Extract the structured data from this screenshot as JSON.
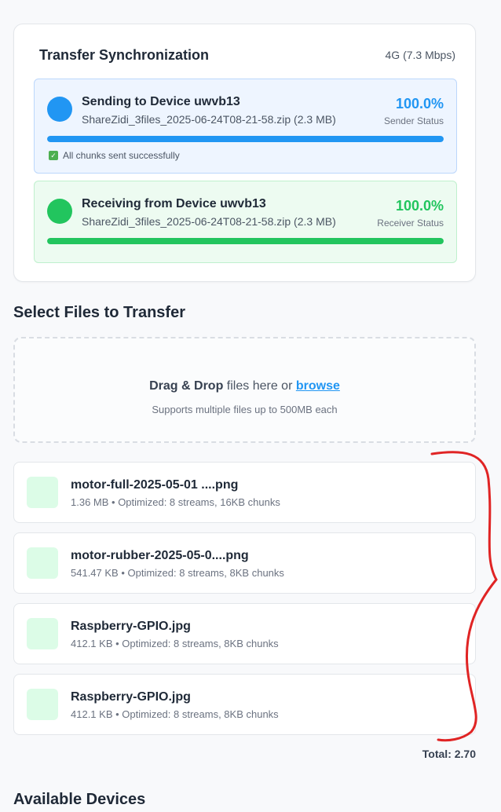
{
  "sync": {
    "title": "Transfer Synchronization",
    "connection": "4G (7.3 Mbps)",
    "sender": {
      "title": "Sending to Device uwvb13",
      "file": "ShareZidi_3files_2025-06-24T08-21-58.zip (2.3 MB)",
      "percent": "100.0%",
      "progress": 1.0,
      "label": "Sender Status",
      "note": "All chunks sent successfully",
      "color": "#2196f3"
    },
    "receiver": {
      "title": "Receiving from Device uwvb13",
      "file": "ShareZidi_3files_2025-06-24T08-21-58.zip (2.3 MB)",
      "percent": "100.0%",
      "progress": 1.0,
      "label": "Receiver Status",
      "color": "#22c55e"
    }
  },
  "select_files": {
    "title": "Select Files to Transfer",
    "drop_prefix": "Drag & Drop",
    "drop_middle": " files here or ",
    "browse_label": "browse",
    "drop_hint": "Supports multiple files up to 500MB each"
  },
  "files": [
    {
      "name": "motor-full-2025-05-01 ....png",
      "meta": "1.36 MB • Optimized: 8 streams, 16KB chunks"
    },
    {
      "name": "motor-rubber-2025-05-0....png",
      "meta": "541.47 KB • Optimized: 8 streams, 8KB chunks"
    },
    {
      "name": "Raspberry-GPIO.jpg",
      "meta": "412.1 KB • Optimized: 8 streams, 8KB chunks"
    },
    {
      "name": "Raspberry-GPIO.jpg",
      "meta": "412.1 KB • Optimized: 8 streams, 8KB chunks"
    }
  ],
  "total": "Total: 2.70",
  "devices": {
    "title": "Available Devices"
  },
  "annotation_color": "#e02424"
}
